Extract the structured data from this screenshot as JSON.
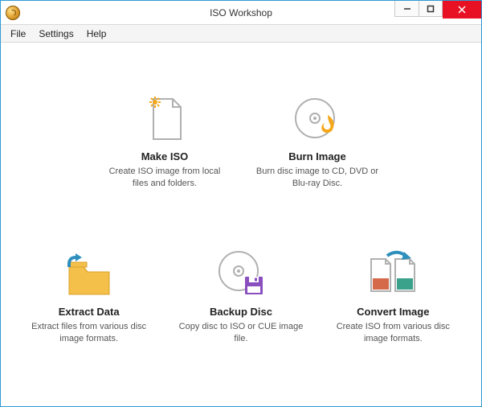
{
  "window": {
    "title": "ISO Workshop"
  },
  "menu": {
    "file": "File",
    "settings": "Settings",
    "help": "Help"
  },
  "cards": {
    "makeiso": {
      "title": "Make ISO",
      "desc": "Create ISO image from local files and folders."
    },
    "burn": {
      "title": "Burn Image",
      "desc": "Burn disc image to CD, DVD or Blu-ray Disc."
    },
    "extract": {
      "title": "Extract Data",
      "desc": "Extract files from various disc image formats."
    },
    "backup": {
      "title": "Backup Disc",
      "desc": "Copy disc to ISO or CUE image file."
    },
    "convert": {
      "title": "Convert Image",
      "desc": "Create ISO from various disc image formats."
    }
  }
}
